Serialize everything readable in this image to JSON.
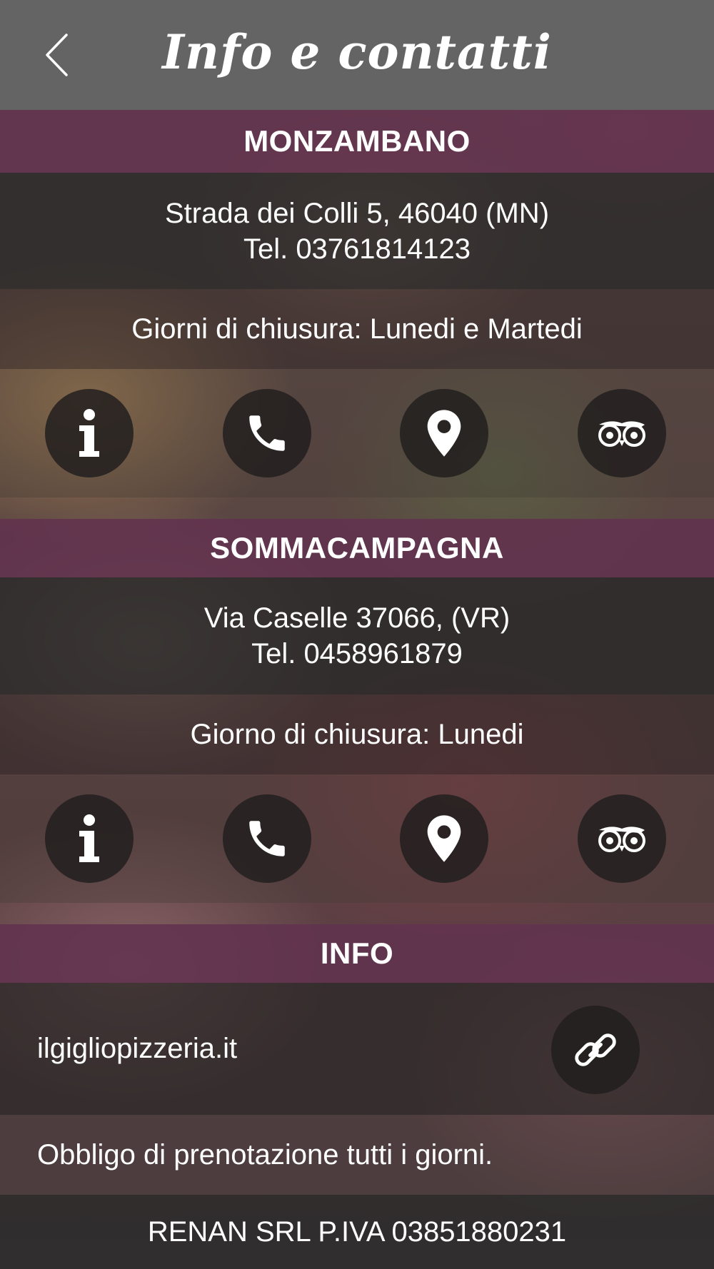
{
  "header": {
    "title": "Info e contatti"
  },
  "locations": [
    {
      "name": "MONZAMBANO",
      "address": "Strada dei Colli 5, 46040 (MN)",
      "phone": "Tel. 03761814123",
      "closing": "Giorni di chiusura: Lunedi e Martedi"
    },
    {
      "name": "SOMMACAMPAGNA",
      "address": "Via Caselle 37066, (VR)",
      "phone": "Tel. 0458961879",
      "closing": "Giorno di chiusura: Lunedi"
    }
  ],
  "info": {
    "title": "INFO",
    "website": "ilgigliopizzeria.it",
    "note": "Obbligo di prenotazione tutti i giorni.",
    "company": "RENAN SRL P.IVA 03851880231"
  },
  "icons": [
    "back-chevron",
    "info-icon",
    "phone-icon",
    "map-pin-icon",
    "tripadvisor-icon",
    "link-icon"
  ],
  "colors": {
    "header": "#646464",
    "section_bar": "#62324e",
    "icon_circle": "#221e1e",
    "text": "#ffffff"
  }
}
